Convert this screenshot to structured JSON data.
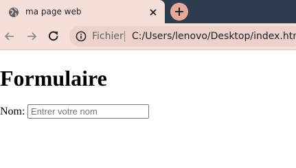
{
  "browser": {
    "tab": {
      "title": "ma page web"
    },
    "address_bar": {
      "scheme_label": "Fichier",
      "url": "C:/Users/lenovo/Desktop/index.html"
    }
  },
  "page": {
    "heading": "Formulaire",
    "form": {
      "name_label": "Nom:",
      "name_placeholder": "Entrer votre nom",
      "name_value": ""
    }
  },
  "colors": {
    "tab_active_bg": "#f6dfd9",
    "tabstrip_bg": "#2d3d4f",
    "new_tab_button": "#e8a899",
    "omnibox_bg": "#ecd2cb"
  },
  "icons": {
    "tab_favicon": "globe-icon",
    "tab_close": "close-icon",
    "new_tab": "plus-icon",
    "back": "arrow-left-icon",
    "forward": "arrow-right-icon",
    "reload": "reload-icon",
    "site_info": "info-icon"
  }
}
